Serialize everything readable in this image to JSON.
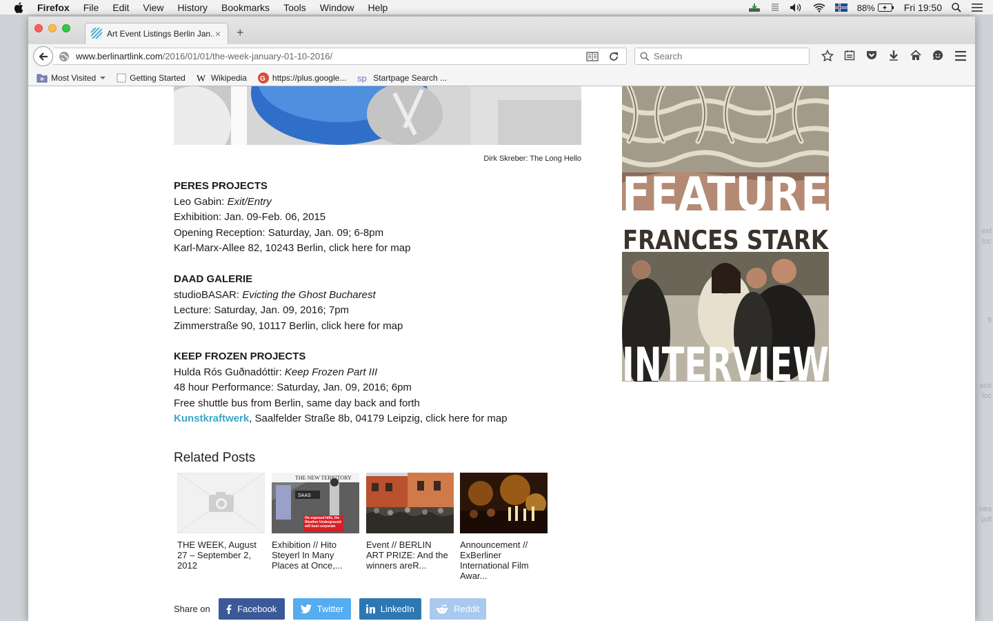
{
  "menubar": {
    "app": "Firefox",
    "items": [
      "File",
      "Edit",
      "View",
      "History",
      "Bookmarks",
      "Tools",
      "Window",
      "Help"
    ],
    "battery": "88%",
    "clock": "Fri 19:50"
  },
  "desktop_ghost": [
    "ext",
    "loc",
    "lt",
    "ace",
    "loc",
    "nes",
    "pdf"
  ],
  "browser": {
    "tab_title": "Art Event Listings Berlin Jan...",
    "tab_close": "×",
    "new_tab": "+",
    "url_host": "www.berlinartlink.com",
    "url_path": "/2016/01/01/the-week-january-01-10-2016/",
    "search_placeholder": "Search",
    "bookmarks": [
      {
        "label": "Most Visited",
        "icon": "folder-icon"
      },
      {
        "label": "Getting Started",
        "icon": "page-icon"
      },
      {
        "label": "Wikipedia",
        "icon": "wikipedia-icon"
      },
      {
        "label": "https://plus.google...",
        "icon": "google-plus-icon"
      },
      {
        "label": "Startpage Search ...",
        "icon": "startpage-icon"
      }
    ]
  },
  "content": {
    "caption": "Dirk Skreber: The Long Hello",
    "listings": [
      {
        "venue": "PERES PROJECTS",
        "artist": "Leo Gabin: ",
        "work": "Exit/Entry",
        "lines": [
          "Exhibition: Jan. 09-Feb. 06, 2015",
          "Opening Reception: Saturday, Jan. 09; 6-8pm",
          "Karl-Marx-Allee 82, 10243 Berlin, click here for map"
        ]
      },
      {
        "venue": "DAAD GALERIE",
        "artist": "studioBASAR: ",
        "work": "Evicting the Ghost Bucharest",
        "lines": [
          "Lecture: Saturday, Jan. 09, 2016; 7pm",
          "Zimmerstraße 90, 10117 Berlin, click here for map"
        ]
      },
      {
        "venue": "KEEP FROZEN PROJECTS",
        "artist": "Hulda Rós Guðnadóttir: ",
        "work": "Keep Frozen Part III",
        "lines": [
          "48 hour Performance: Saturday, Jan. 09, 2016; 6pm",
          "Free shuttle bus from Berlin, same day back and forth"
        ],
        "link": "Kunstkraftwerk",
        "link_rest": ", Saalfelder Straße 8b, 04179 Leipzig, click here for map"
      }
    ],
    "related_title": "Related Posts",
    "related": [
      {
        "title": "THE WEEK, August 27 – September 2, 2012"
      },
      {
        "title": "Exhibition // Hito Steyerl In Many Places at Once,..."
      },
      {
        "title": "Event // BERLIN ART PRIZE: And the winners areR..."
      },
      {
        "title": "Announcement // ExBerliner International Film Awar..."
      }
    ],
    "thumb_text": {
      "territory": "THE NEW TERRITORY",
      "saas": "SAAS",
      "weather": "On exposed hills, the Weather Underground will bust corporate"
    },
    "share_label": "Share on",
    "share_buttons": [
      {
        "label": "Facebook",
        "color": "#3b5998"
      },
      {
        "label": "Twitter",
        "color": "#55acee"
      },
      {
        "label": "LinkedIn",
        "color": "#2d77b3"
      },
      {
        "label": "Reddit",
        "color": "#a9c9ee"
      }
    ],
    "sidebar": {
      "feature": "FEATURE",
      "name": "FRANCES STARK",
      "interview": "INTERVIEW"
    }
  }
}
